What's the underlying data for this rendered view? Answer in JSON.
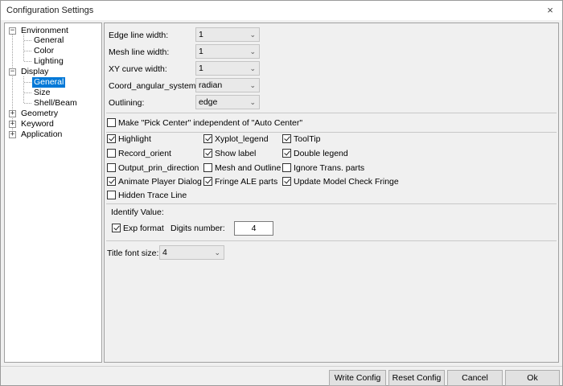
{
  "window": {
    "title": "Configuration Settings",
    "close_glyph": "×"
  },
  "tree": {
    "environment": "Environment",
    "env_general": "General",
    "env_color": "Color",
    "env_lighting": "Lighting",
    "display": "Display",
    "disp_general": "General",
    "disp_size": "Size",
    "disp_shellbeam": "Shell/Beam",
    "geometry": "Geometry",
    "keyword": "Keyword",
    "application": "Application",
    "expanded_glyph": "−",
    "collapsed_glyph": "+"
  },
  "fields": {
    "edge_line_width": {
      "label": "Edge line width:",
      "value": "1"
    },
    "mesh_line_width": {
      "label": "Mesh line width:",
      "value": "1"
    },
    "xy_curve_width": {
      "label": "XY curve width:",
      "value": "1"
    },
    "coord_angular_system": {
      "label": "Coord_angular_system:",
      "value": "radian"
    },
    "outlining": {
      "label": "Outlining:",
      "value": "edge"
    }
  },
  "pick_center": {
    "label": "Make \"Pick Center\" independent of \"Auto Center\"",
    "checked": false
  },
  "checkboxes": {
    "highlight": {
      "label": "Highlight",
      "checked": true
    },
    "xyplot_legend": {
      "label": "Xyplot_legend",
      "checked": true
    },
    "tooltip": {
      "label": "ToolTip",
      "checked": true
    },
    "record_orient": {
      "label": "Record_orient",
      "checked": false
    },
    "show_label": {
      "label": "Show label",
      "checked": true
    },
    "double_legend": {
      "label": "Double legend",
      "checked": true
    },
    "output_prin_direction": {
      "label": "Output_prin_direction",
      "checked": false
    },
    "mesh_and_outline": {
      "label": "Mesh and Outline",
      "checked": false
    },
    "ignore_trans_parts": {
      "label": "Ignore Trans. parts",
      "checked": false
    },
    "animate_player_dialog": {
      "label": "Animate Player Dialog",
      "checked": true
    },
    "fringe_ale_parts": {
      "label": "Fringe ALE parts",
      "checked": true
    },
    "update_model_check_fringe": {
      "label": "Update Model Check Fringe",
      "checked": true
    },
    "hidden_trace_line": {
      "label": "Hidden Trace Line",
      "checked": false
    }
  },
  "identify": {
    "label": "Identify Value:",
    "exp_format": {
      "label": "Exp format",
      "checked": true
    },
    "digits_label": "Digits number:",
    "digits_value": "4"
  },
  "title_font": {
    "label": "Title font size:",
    "value": "4"
  },
  "buttons": {
    "write_config": "Write Config",
    "reset_config": "Reset Config",
    "cancel": "Cancel",
    "ok": "Ok"
  }
}
